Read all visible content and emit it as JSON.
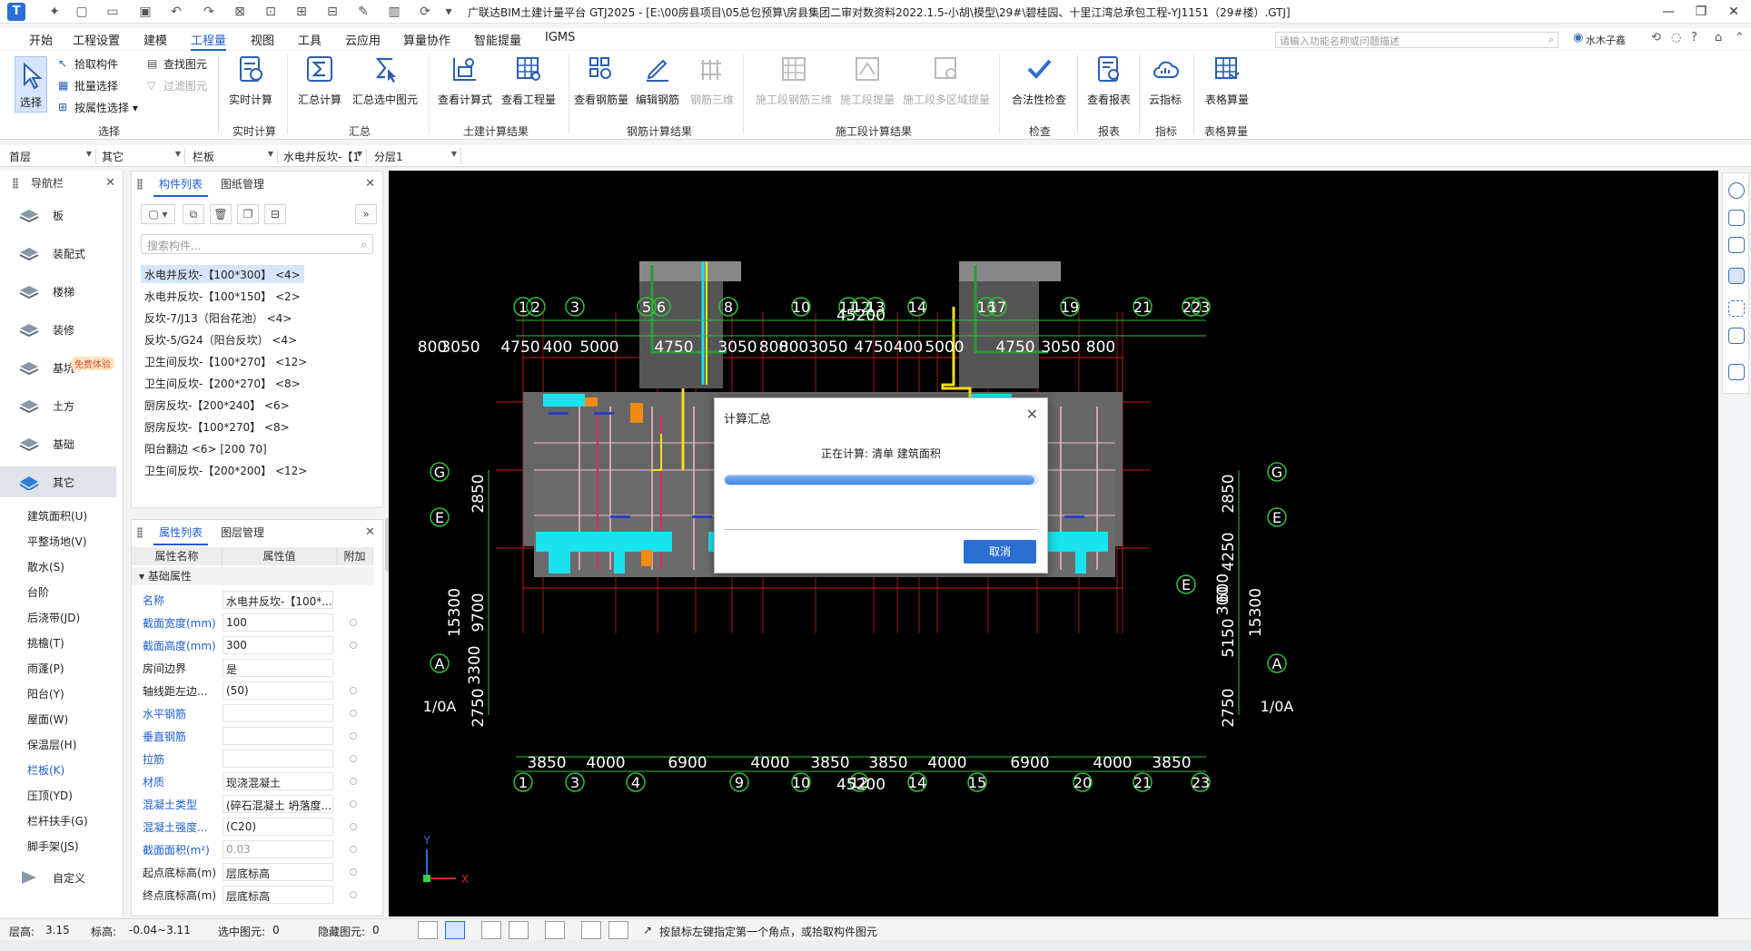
{
  "window": {
    "title": "广联达BIM土建计量平台 GTJ2025 - [E:\\00房县项目\\05总包预算\\房县集团二审对数资料2022.1.5-小胡\\模型\\29#\\碧桂园、十里江湾总承包工程-YJ1151（29#楼）.GTJ]"
  },
  "menu": {
    "items": [
      "开始",
      "工程设置",
      "建模",
      "工程量",
      "视图",
      "工具",
      "云应用",
      "算量协作",
      "智能提量",
      "IGMS"
    ],
    "active": "工程量",
    "search_placeholder": "请输入功能名称或问题描述",
    "user": "水木子鑫"
  },
  "ribbon": {
    "select_label": "选择",
    "select_small": [
      "拾取构件",
      "批量选择",
      "按属性选择"
    ],
    "find_small": [
      "查找图元",
      "过滤图元"
    ],
    "buttons": {
      "realtime_calc": "实时计算",
      "summary_calc": "汇总计算",
      "summary_selected": "汇总选中图元",
      "view_formula": "查看计算式",
      "view_quantity": "查看工程量",
      "view_rebar": "查看钢筋量",
      "edit_rebar": "编辑钢筋",
      "rebar_3d": "钢筋三维",
      "stage_rebar_3d": "施工段钢筋三维",
      "stage_quantity": "施工段提量",
      "stage_multi": "施工段多区域提量",
      "validity_check": "合法性检查",
      "view_report": "查看报表",
      "cloud_index": "云指标",
      "table_calc": "表格算量"
    },
    "groups": [
      "选择",
      "实时计算",
      "汇总",
      "土建计算结果",
      "钢筋计算结果",
      "施工段计算结果",
      "检查",
      "报表",
      "指标",
      "表格算量"
    ]
  },
  "filter": {
    "floor": "首层",
    "category": "其它",
    "type": "栏板",
    "component": "水电井反坎-【1",
    "layer": "分层1"
  },
  "nav": {
    "title": "导航栏",
    "items": [
      "板",
      "装配式",
      "楼梯",
      "装修",
      "基坑",
      "土方",
      "基础",
      "其它"
    ],
    "active": "其它",
    "badge": "免费体验",
    "sub_items": [
      "建筑面积(U)",
      "平整场地(V)",
      "散水(S)",
      "台阶",
      "后浇带(JD)",
      "挑檐(T)",
      "雨蓬(P)",
      "阳台(Y)",
      "屋面(W)",
      "保温层(H)",
      "栏板(K)",
      "压顶(YD)",
      "栏杆扶手(G)",
      "脚手架(JS)"
    ],
    "active_sub": "栏板(K)",
    "custom": "自定义"
  },
  "component_list": {
    "tabs": [
      "构件列表",
      "图纸管理"
    ],
    "search_placeholder": "搜索构件...",
    "items": [
      "水电井反坎-【100*300】 <4>",
      "水电井反坎-【100*150】 <2>",
      "反坎-7/J13（阳台花池） <4>",
      "反坎-5/G24（阳台反坎） <4>",
      "卫生间反坎-【100*270】 <12>",
      "卫生间反坎-【200*270】 <8>",
      "厨房反坎-【200*240】 <6>",
      "厨房反坎-【100*270】 <8>",
      "阳台翻边 <6> [200 70]",
      "卫生间反坎-【200*200】 <12>"
    ],
    "selected_index": 0
  },
  "properties": {
    "tabs": [
      "属性列表",
      "图层管理"
    ],
    "headers": [
      "属性名称",
      "属性值",
      "附加"
    ],
    "group": "基础属性",
    "rows": [
      {
        "name": "名称",
        "value": "水电井反坎-【100*...",
        "blue": true,
        "attach": false
      },
      {
        "name": "截面宽度(mm)",
        "value": "100",
        "blue": true,
        "attach": true
      },
      {
        "name": "截面高度(mm)",
        "value": "300",
        "blue": true,
        "attach": true
      },
      {
        "name": "房间边界",
        "value": "是",
        "blue": false,
        "attach": false
      },
      {
        "name": "轴线距左边...",
        "value": "(50)",
        "blue": false,
        "attach": true
      },
      {
        "name": "水平钢筋",
        "value": "",
        "blue": true,
        "attach": true
      },
      {
        "name": "垂直钢筋",
        "value": "",
        "blue": true,
        "attach": true
      },
      {
        "name": "拉筋",
        "value": "",
        "blue": true,
        "attach": true
      },
      {
        "name": "材质",
        "value": "现浇混凝土",
        "blue": true,
        "attach": true
      },
      {
        "name": "混凝土类型",
        "value": "(碎石混凝土 坍落度...",
        "blue": true,
        "attach": true
      },
      {
        "name": "混凝土强度...",
        "value": "(C20)",
        "blue": true,
        "attach": true
      },
      {
        "name": "截面面积(m²)",
        "value": "0.03",
        "blue": true,
        "attach": true,
        "gray": true
      },
      {
        "name": "起点底标高(m)",
        "value": "层底标高",
        "blue": false,
        "attach": true
      },
      {
        "name": "终点底标高(m)",
        "value": "层底标高",
        "blue": false,
        "attach": true
      }
    ]
  },
  "drawing": {
    "top_axes": [
      "1",
      "2",
      "3",
      "5",
      "6",
      "8",
      "10",
      "11",
      "12",
      "13",
      "14",
      "16",
      "17",
      "19",
      "21",
      "22",
      "23"
    ],
    "top_total": "45200",
    "top_dims": [
      "800",
      "3050",
      "4750",
      "400",
      "5000",
      "4750",
      "3050",
      "800",
      "800",
      "3050",
      "4750",
      "400",
      "5000",
      "4750",
      "3050",
      "800"
    ],
    "row_axes": [
      "G",
      "E",
      "A",
      "1/0A"
    ],
    "left_dims": [
      "2850",
      "15300",
      "9700",
      "2750"
    ],
    "right_dims": [
      "2850",
      "4250",
      "15300",
      "300",
      "600",
      "5150",
      "2750"
    ],
    "right_axis_extra": "E",
    "bottom_dims": [
      "3850",
      "4000",
      "6900",
      "4000",
      "3850",
      "3850",
      "4000",
      "6900",
      "4000",
      "3850"
    ],
    "bottom_total": "45200",
    "bottom_axes": [
      "1",
      "3",
      "4",
      "9",
      "10",
      "12",
      "14",
      "15",
      "20",
      "21",
      "23"
    ],
    "inner_label": "3300",
    "ucs_x": "X",
    "ucs_y": "Y"
  },
  "dialog": {
    "title": "计算汇总",
    "status": "正在计算: 清单 建筑面积",
    "progress": 0.99,
    "cancel": "取消"
  },
  "statusbar": {
    "floor_height_label": "层高:",
    "floor_height": "3.15",
    "elev_label": "标高:",
    "elev": "-0.04~3.11",
    "selected_label": "选中图元:",
    "selected": "0",
    "hidden_label": "隐藏图元:",
    "hidden": "0",
    "hint": "按鼠标左键指定第一个角点，或拾取构件图元"
  },
  "colors": {
    "accent": "#1f5fd1",
    "canvas_bg": "#000000",
    "axis_green": "#2fbf3a",
    "cyan": "#19e3ee",
    "orange": "#f08a10",
    "yellow": "#f2e012",
    "magenta": "#e0227a"
  }
}
